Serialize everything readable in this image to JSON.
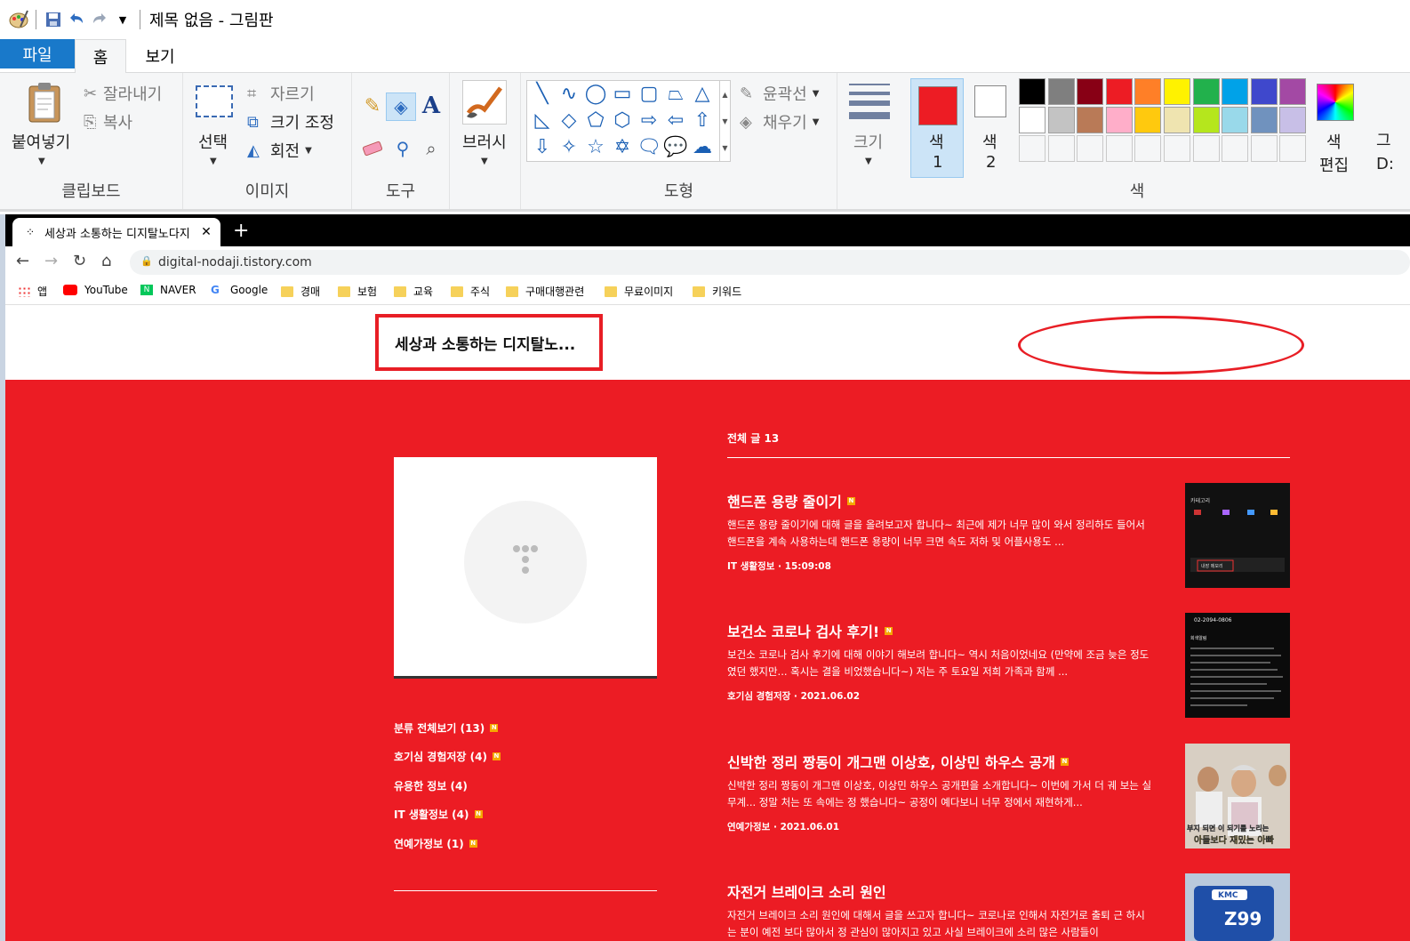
{
  "titlebar": {
    "title": "제목 없음 - 그림판"
  },
  "menu_tabs": {
    "file": "파일",
    "home": "홈",
    "view": "보기"
  },
  "ribbon": {
    "clipboard": {
      "paste": "붙여넣기",
      "cut": "잘라내기",
      "copy": "복사",
      "label": "클립보드"
    },
    "image": {
      "select": "선택",
      "crop": "자르기",
      "resize": "크기 조정",
      "rotate": "회전",
      "label": "이미지"
    },
    "tools": {
      "label": "도구"
    },
    "brush": {
      "label": "브러시"
    },
    "shapes": {
      "outline": "윤곽선",
      "fill": "채우기",
      "label": "도형"
    },
    "size": {
      "label": "크기"
    },
    "colors": {
      "color1_line1": "색",
      "color1_line2": "1",
      "color2_line1": "색",
      "color2_line2": "2",
      "edit_line1": "색",
      "edit_line2": "편집",
      "label": "색",
      "color1_value": "#ed1c24",
      "color2_value": "#ffffff",
      "palette_row1": [
        "#000000",
        "#7f7f7f",
        "#880015",
        "#ed1c24",
        "#ff7f27",
        "#fff200",
        "#22b14c",
        "#00a2e8",
        "#3f48cc",
        "#a349a4"
      ],
      "palette_row2": [
        "#ffffff",
        "#c3c3c3",
        "#b97a57",
        "#ffaec9",
        "#ffc90e",
        "#efe4b0",
        "#b5e61d",
        "#99d9ea",
        "#7092be",
        "#c8bfe7"
      ],
      "clipped_next_label": "그 D:"
    }
  },
  "browser": {
    "tab_title": "세상과 소통하는 디지탈노다지",
    "url": "digital-nodaji.tistory.com",
    "bookmarks": [
      "앱",
      "YouTube",
      "NAVER",
      "Google",
      "경매",
      "보험",
      "교육",
      "주식",
      "구매대행관련",
      "무료이미지",
      "키워드"
    ]
  },
  "blog": {
    "site_title": "세상과 소통하는 디지탈노...",
    "total_posts": "전체 글 13",
    "categories": [
      "분류 전체보기 (13)",
      "호기심 경험저장 (4)",
      "유용한 정보 (4)",
      "IT 생활정보 (4)",
      "연예가정보 (1)"
    ],
    "posts": [
      {
        "title": "핸드폰 용량 줄이기",
        "body": "핸드폰 용량 줄이기에 대해 글을 올려보고자 합니다~ 최근에 제가 너무 많이 와서 정리하도 들어서 핸드폰을 계속 사용하는데 핸드폰 용량이 너무 크면 속도 저하 및 어플사용도 ...",
        "meta": "IT 생활정보 · 15:09:08"
      },
      {
        "title": "보건소 코로나 검사 후기!",
        "body": "보건소 코로나 검사 후기에 대해 이야기 해보려 합니다~ 역시 처음이었네요 (만약에 조금 늦은 정도 였던 했지만... 혹시는 결을 비었했습니다~) 저는 주 토요일 저희 가족과 함께 ...",
        "meta": "호기심 경험저장 · 2021.06.02"
      },
      {
        "title": "신박한 정리 짱동이 개그맨 이상호, 이상민 하우스 공개",
        "body": "신박한 정리 짱동이 개그맨 이상호, 이상민 하우스 공개편을 소개합니다~ 이번에 가서 더 궤 보는 실무계... 정말 처는 또 속에는 정 했습니다~ 공정이 예다보니 너무 정에서 재현하게...",
        "meta": "연예가정보 · 2021.06.01"
      },
      {
        "title": "자전거 브레이크 소리 원인",
        "body": "자전거 브레이크 소리 원인에 대해서 글을 쓰고자 합니다~ 코로나로 인해서 자전거로 출퇴 근 하시는 분이 예전 보다 많아서 정 관심이 많아지고 있고 사실 브레이크에 소리 많은 사람들이",
        "meta": ""
      }
    ],
    "thumb1_lines": [
      "카테고리",
      "내장 메모리"
    ],
    "thumb2_lines": [
      "02-2094-0806",
      "회색알림"
    ],
    "thumb3_lines": [
      "부지 되면 이 되기를 노리는",
      "아들보다 재밌는 아빠"
    ],
    "thumb4_lines": [
      "KMC",
      "Z99"
    ]
  }
}
